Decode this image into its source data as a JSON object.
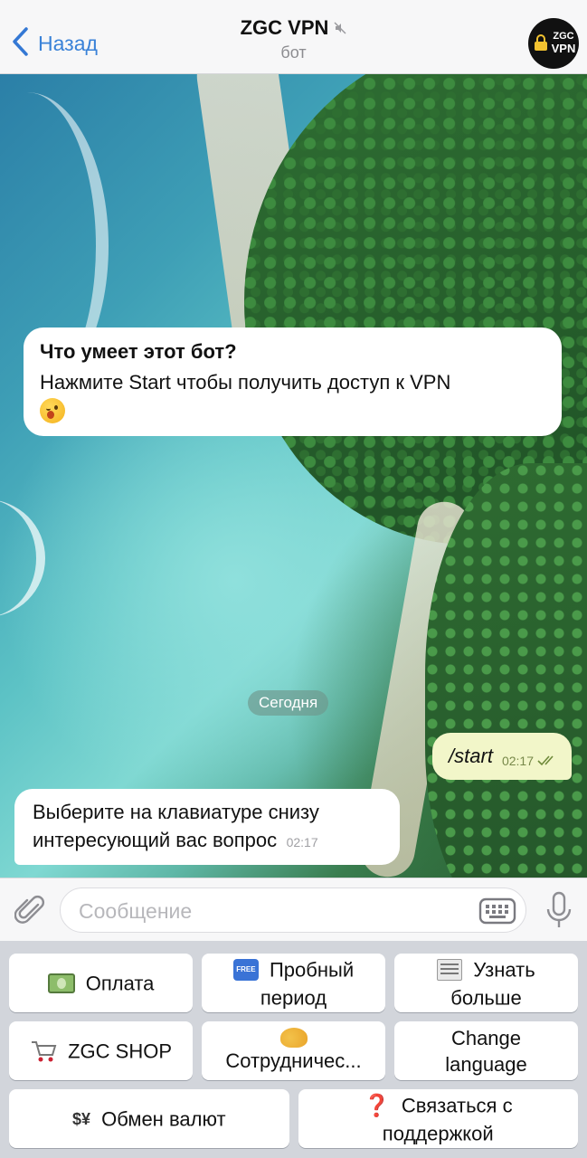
{
  "header": {
    "back_label": "Назад",
    "title": "ZGC VPN",
    "subtitle": "бот",
    "avatar_text_line1": "ZGC",
    "avatar_text_line2": "VPN"
  },
  "chat": {
    "intro_title": "Что умеет этот бот?",
    "intro_text": "Нажмите Start чтобы получить доступ к VPN",
    "intro_emoji": "wink-emoji",
    "date_separator": "Сегодня",
    "messages": [
      {
        "side": "out",
        "text": "/start",
        "time": "02:17",
        "status": "read"
      },
      {
        "side": "in",
        "text": "Выберите на клавиатуре снизу интересующий вас вопрос",
        "time": "02:17"
      }
    ]
  },
  "composer": {
    "placeholder": "Сообщение"
  },
  "keyboard": {
    "rows": [
      [
        {
          "label": "Оплата",
          "icon": "money-icon"
        },
        {
          "label": "Пробный период",
          "icon": "free-icon"
        },
        {
          "label": "Узнать больше",
          "icon": "newspaper-icon"
        }
      ],
      [
        {
          "label": "ZGC SHOP",
          "icon": "cart-icon"
        },
        {
          "label": "Сотрудничес...",
          "icon": "handshake-icon"
        },
        {
          "label": "Change language",
          "icon": ""
        }
      ],
      [
        {
          "label": "Обмен валют",
          "icon": "exchange-icon",
          "icon_glyph": "$¥"
        },
        {
          "label": "Связаться с поддержкой",
          "icon": "question-icon",
          "icon_glyph": "❓"
        }
      ]
    ]
  },
  "colors": {
    "accent": "#3478d4",
    "outgoing_bubble": "#f2f6c9",
    "keyboard_bg": "#d2d5db"
  }
}
